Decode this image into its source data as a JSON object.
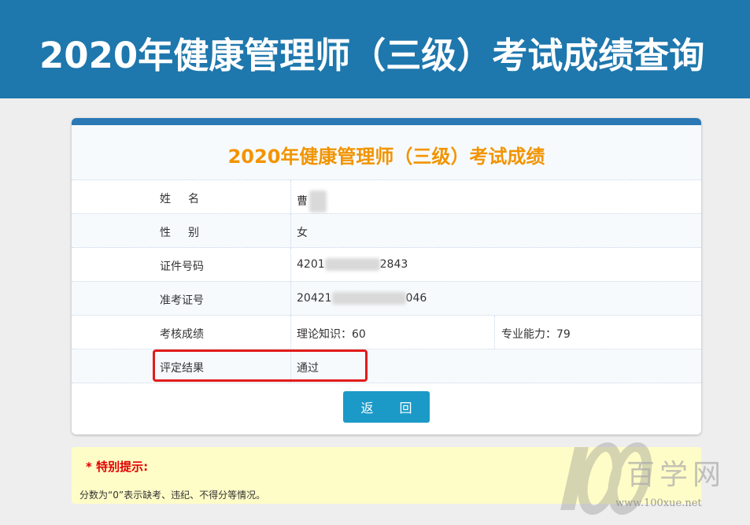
{
  "banner": {
    "title": "2020年健康管理师（三级）考试成绩查询"
  },
  "card": {
    "title": "2020年健康管理师（三级）考试成绩",
    "rows": [
      {
        "label": "姓名",
        "value": "曹"
      },
      {
        "label": "性别",
        "value": "女"
      },
      {
        "label": "证件号码",
        "value_prefix": "4201",
        "value_suffix": "2843"
      },
      {
        "label": "准考证号",
        "value_prefix": "20421",
        "value_suffix": "046"
      },
      {
        "label": "考核成绩",
        "value": "理论知识：60",
        "value2": "专业能力：79"
      },
      {
        "label": "评定结果",
        "value": "通过"
      }
    ],
    "back_button": "返 回"
  },
  "notice": {
    "title": "* 特别提示:",
    "text": "分数为“0”表示缺考、违纪、不得分等情况。"
  },
  "watermark": {
    "brand": "百学网",
    "url": "www.100xue.net",
    "logo_digits": "100"
  },
  "colors": {
    "banner": "#1e77ad",
    "title_orange": "#f29400",
    "button": "#1b9ac8",
    "highlight": "#e21b1b",
    "notice_bg": "#fffdc7",
    "notice_title": "#e20000"
  }
}
